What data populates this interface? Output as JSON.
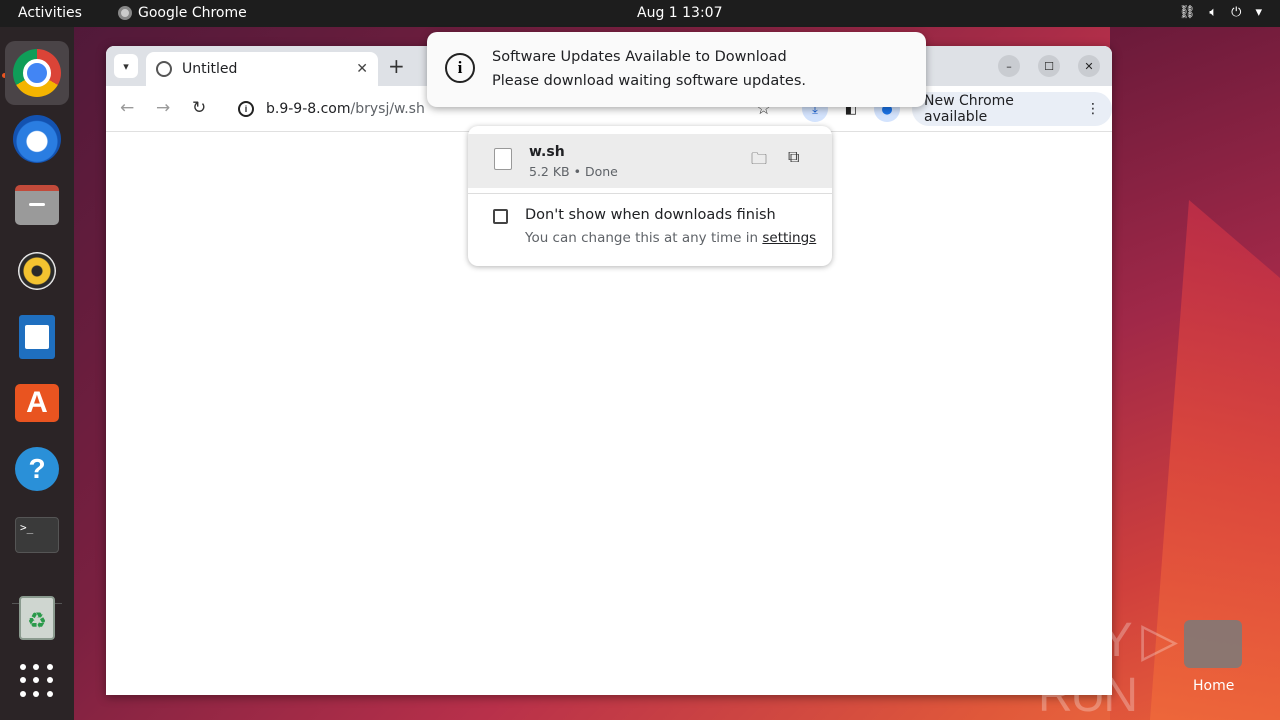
{
  "topbar": {
    "activities": "Activities",
    "app_name": "Google Chrome",
    "clock": "Aug 1  13:07",
    "tray_icons": [
      "network-icon",
      "volume-icon",
      "power-icon"
    ]
  },
  "dock": {
    "items": [
      {
        "name": "Google Chrome",
        "icon": "chrome-icon",
        "active": true
      },
      {
        "name": "Thunderbird",
        "icon": "thunderbird-icon"
      },
      {
        "name": "Files",
        "icon": "files-icon"
      },
      {
        "name": "Rhythmbox",
        "icon": "rhythmbox-icon"
      },
      {
        "name": "LibreOffice Writer",
        "icon": "writer-icon"
      },
      {
        "name": "Ubuntu Software",
        "icon": "app-store-icon"
      },
      {
        "name": "Help",
        "icon": "help-icon"
      },
      {
        "name": "Terminal",
        "icon": "terminal-icon"
      },
      {
        "name": "Trash",
        "icon": "trash-icon"
      },
      {
        "name": "Show Applications",
        "icon": "app-grid-icon"
      }
    ],
    "terminal_glyph": ">_",
    "store_glyph": "A",
    "help_glyph": "?",
    "trash_glyph": "♻"
  },
  "browser": {
    "tab_title": "Untitled",
    "url_host": "b.9-9-8.com",
    "url_path": "/brysj/w.sh",
    "new_chrome_label": "New Chrome available"
  },
  "downloads": {
    "file_name": "w.sh",
    "file_meta": "5.2 KB • Done",
    "checkbox_label": "Don't show when downloads finish",
    "hint_text": "You can change this at any time in",
    "settings_link": "settings",
    "checked": false
  },
  "notification": {
    "title": "Software Updates Available to Download",
    "body": "Please download waiting software updates."
  },
  "desktop": {
    "home_label": "Home",
    "watermark": "ANY ▷ RUN"
  },
  "colors": {
    "accent": "#e95420",
    "download_highlight": "#d3e3fd",
    "link_blue": "#0b57d0"
  }
}
